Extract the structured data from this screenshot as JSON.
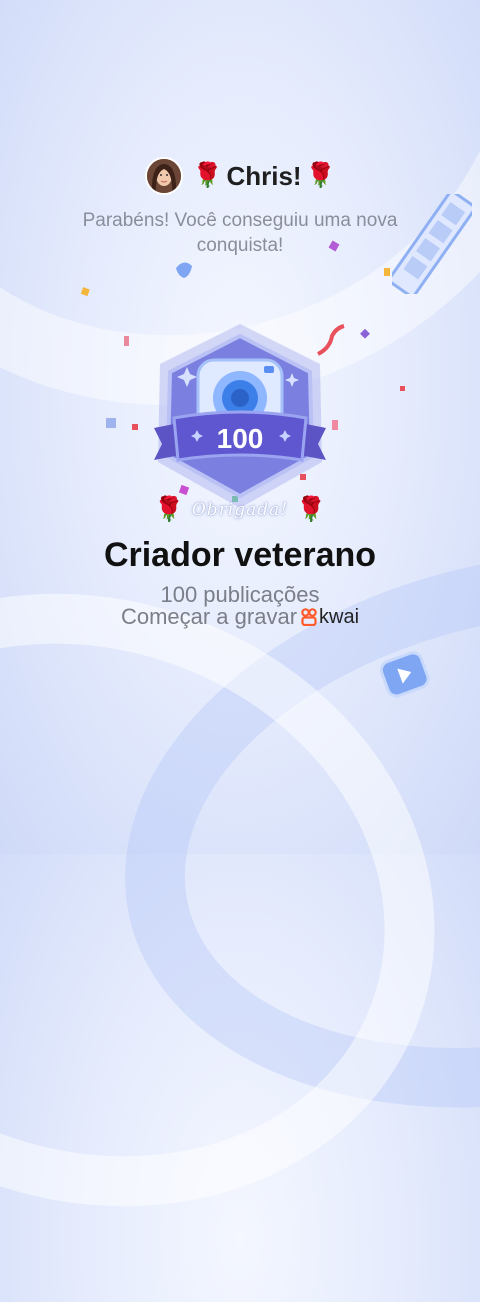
{
  "header": {
    "rose_left": "🌹",
    "username": "Chris!",
    "rose_right": "🌹"
  },
  "congrats_message": "Parabéns! Você conseguiu uma nova conquista!",
  "badge": {
    "number": "100"
  },
  "signature": {
    "rose_left": "🌹",
    "text": "Obrigada!",
    "rose_right": "🌹"
  },
  "achievement": {
    "title": "Criador veterano",
    "publications": "100 publicações",
    "cta": "Começar a gravar",
    "brand": "kwai"
  },
  "icons": [
    "avatar",
    "rose-icon",
    "camera-badge-icon",
    "film-strip-icon",
    "play-button-icon",
    "kwai-logo-icon",
    "confetti"
  ],
  "colors": {
    "accent_purple": "#6f63d6",
    "badge_blue": "#4f8ef0",
    "kwai_orange": "#ff5a2a"
  }
}
